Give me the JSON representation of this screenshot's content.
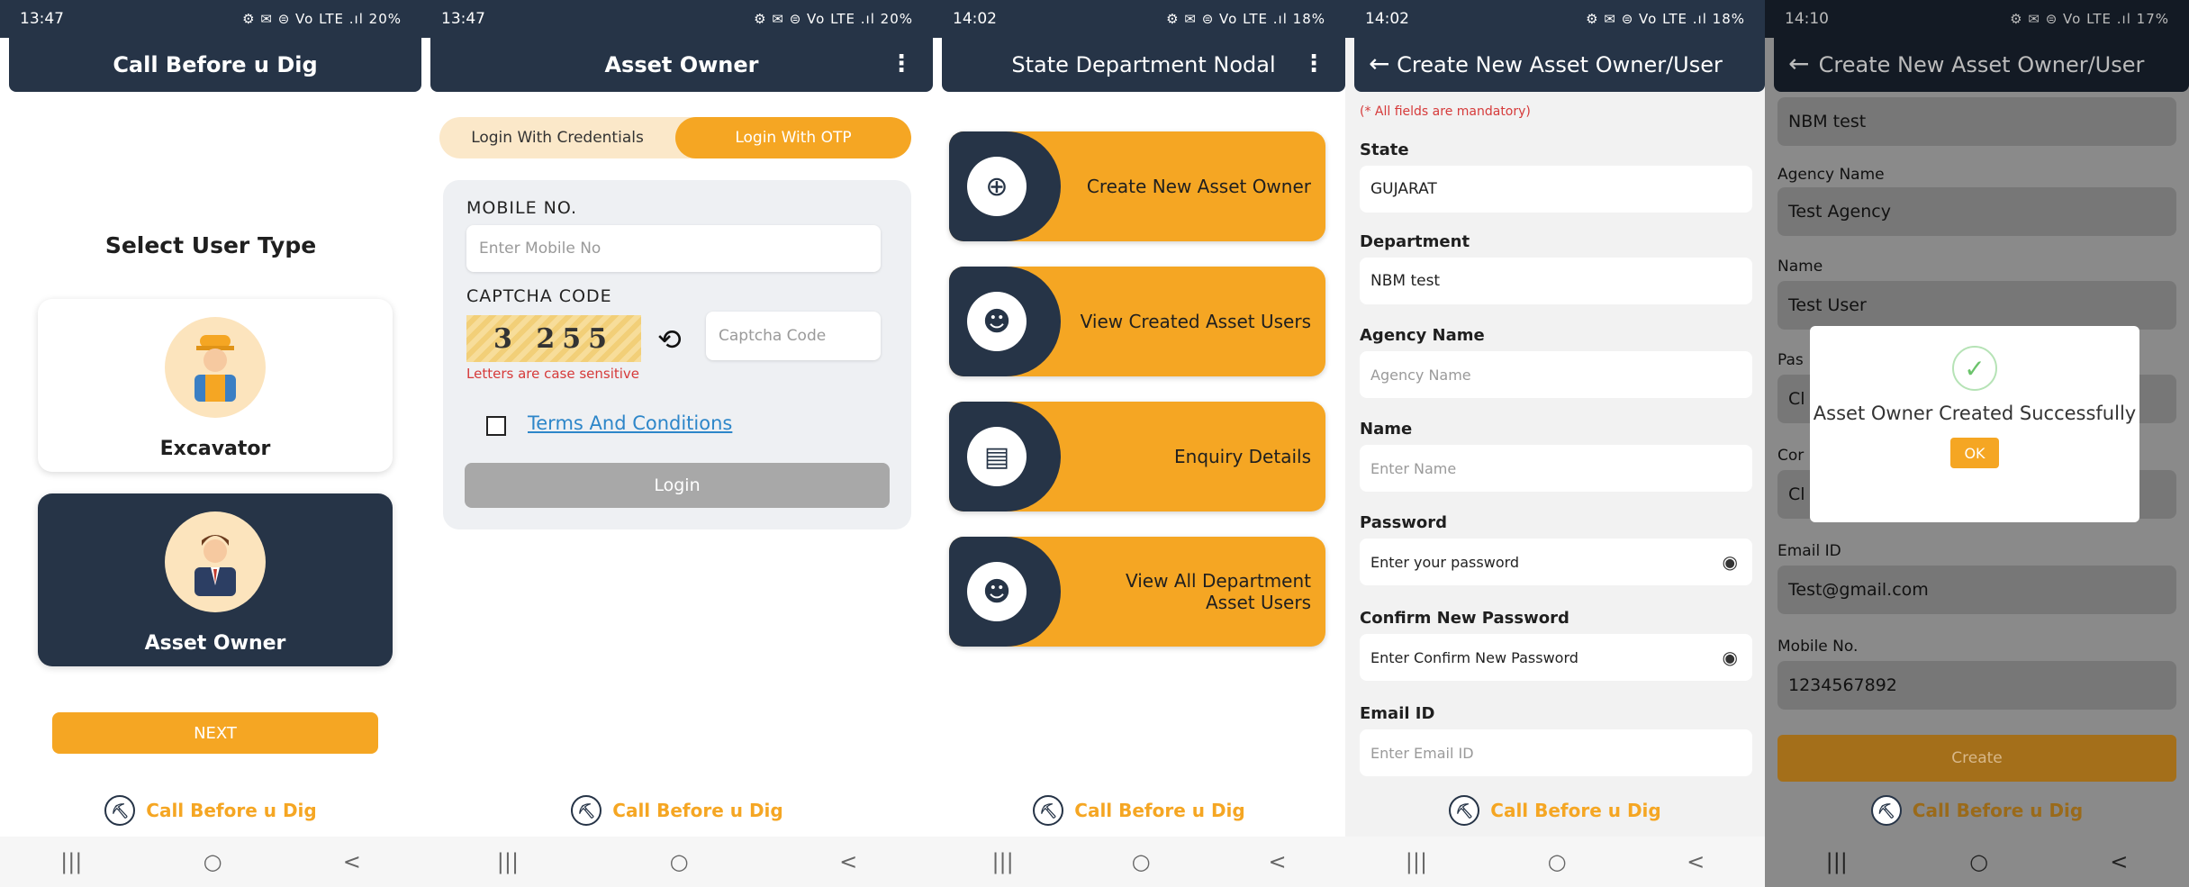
{
  "screens": [
    {
      "status": {
        "time": "13:47",
        "right": "⚙ ✉ ⊜ Vo LTE .ıl 20%"
      },
      "appbar": {
        "title": "Call Before u Dig"
      },
      "heading": "Select User Type",
      "cards": [
        {
          "label": "Excavator"
        },
        {
          "label": "Asset Owner"
        }
      ],
      "next_label": "NEXT",
      "footer_brand": "Call Before u Dig"
    },
    {
      "status": {
        "time": "13:47",
        "right": "⚙ ✉ ⊜ Vo LTE .ıl 20%"
      },
      "appbar": {
        "title": "Asset Owner"
      },
      "toggle": {
        "credentials": "Login With Credentials",
        "otp": "Login With OTP"
      },
      "mobile_label": "MOBILE NO.",
      "mobile_placeholder": "Enter Mobile No",
      "captcha_label": "CAPTCHA CODE",
      "captcha_value": "3 255",
      "captcha_placeholder": "Captcha Code",
      "case_note": "Letters are case sensitive",
      "terms_label": "Terms And Conditions",
      "login_label": "Login",
      "footer_brand": "Call Before u Dig"
    },
    {
      "status": {
        "time": "14:02",
        "right": "⚙ ✉ ⊜ Vo LTE .ıl 18%"
      },
      "appbar": {
        "title": "State Department Nodal"
      },
      "menu": [
        {
          "label": "Create New Asset Owner",
          "icon": "add-user-icon"
        },
        {
          "label": "View Created Asset Users",
          "icon": "user-check-icon"
        },
        {
          "label": "Enquiry Details",
          "icon": "document-icon"
        },
        {
          "label": "View All Department Asset Users",
          "icon": "user-check-icon"
        }
      ],
      "footer_brand": "Call Before u Dig"
    },
    {
      "status": {
        "time": "14:02",
        "right": "⚙ ✉ ⊜ Vo LTE .ıl 18%"
      },
      "appbar": {
        "title": "Create New Asset Owner/User"
      },
      "mandatory_note": "(* All fields are mandatory)",
      "fields": [
        {
          "label": "State",
          "value": "GUJARAT"
        },
        {
          "label": "Department",
          "value": "NBM test"
        },
        {
          "label": "Agency Name",
          "placeholder": "Agency Name"
        },
        {
          "label": "Name",
          "placeholder": "Enter Name"
        },
        {
          "label": "Password",
          "placeholder": "Enter your password"
        },
        {
          "label": "Confirm New Password",
          "placeholder": "Enter Confirm New Password"
        },
        {
          "label": "Email ID",
          "placeholder": "Enter Email ID"
        }
      ],
      "footer_brand": "Call Before u Dig"
    },
    {
      "status": {
        "time": "14:10",
        "right": "⚙ ✉ ⊜ Vo LTE .ıl 17%"
      },
      "appbar": {
        "title": "Create New Asset Owner/User"
      },
      "dept_value": "NBM test",
      "agency_label": "Agency Name",
      "agency_value": "Test Agency",
      "name_label": "Name",
      "name_value": "Test User",
      "pass_label_partial": "Pas",
      "pass_value_partial": "Cl",
      "conf_label_partial": "Cor",
      "conf_value_partial": "Cl",
      "email_label": "Email ID",
      "email_value": "Test@gmail.com",
      "mobile_label": "Mobile No.",
      "mobile_value": "1234567892",
      "create_label": "Create",
      "dialog": {
        "message": "Asset Owner Created Successfully",
        "ok": "OK"
      },
      "footer_brand": "Call Before u Dig"
    }
  ],
  "nav_buttons": {
    "recents": "|||",
    "home": "○",
    "back": "<"
  },
  "colors": {
    "navy": "#263447",
    "orange": "#f5a623",
    "red": "#d63a3a",
    "link": "#2d86c9"
  }
}
